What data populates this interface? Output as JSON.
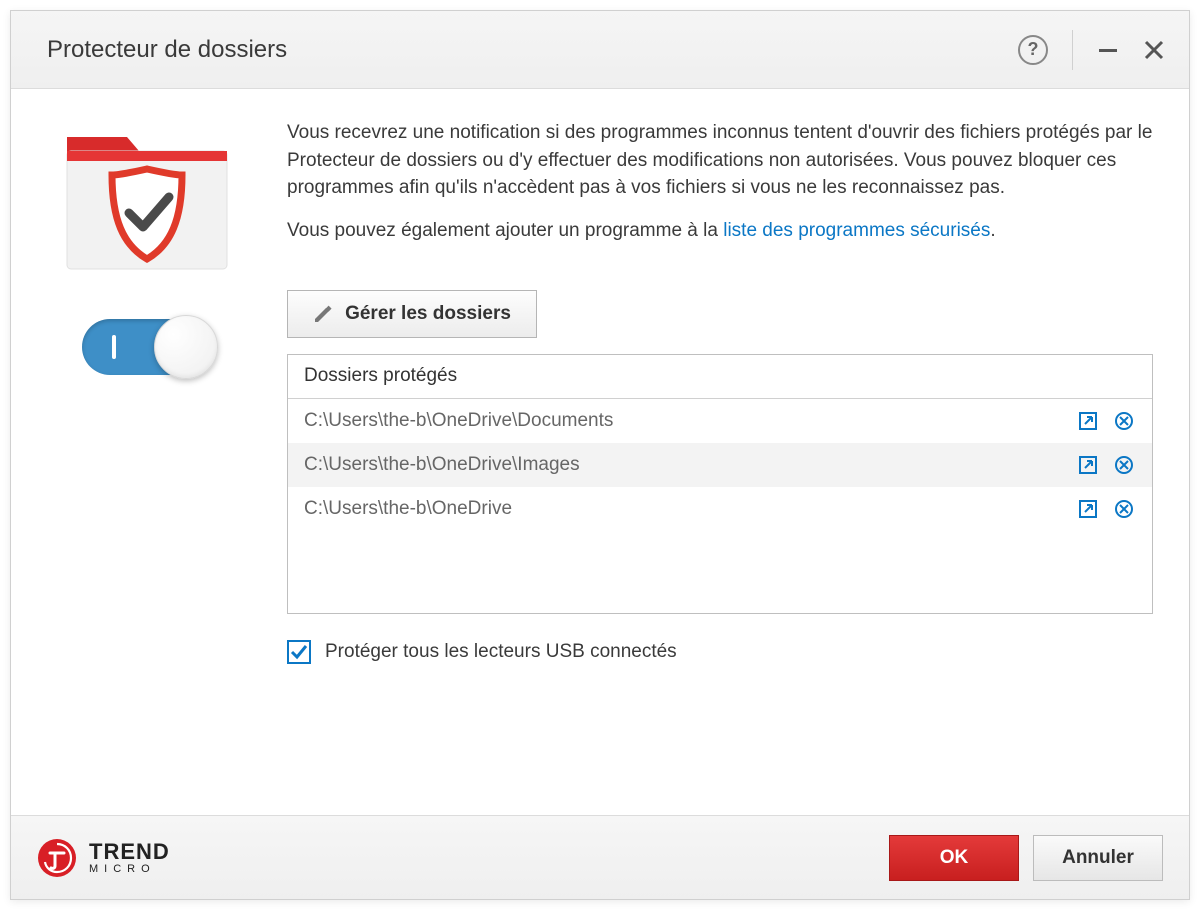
{
  "window": {
    "title": "Protecteur de dossiers"
  },
  "description": "Vous recevrez une notification si des programmes inconnus tentent d'ouvrir des fichiers protégés par le Protecteur de dossiers ou d'y effectuer des modifications non autorisées. Vous pouvez bloquer ces programmes afin qu'ils n'accèdent pas à vos fichiers si vous ne les reconnaissez pas.",
  "description2_prefix": "Vous pouvez également ajouter un programme à la ",
  "description2_link": "liste des programmes sécurisés",
  "description2_suffix": ".",
  "manage_button": "Gérer les dossiers",
  "list": {
    "header": "Dossiers protégés",
    "rows": [
      {
        "path": "C:\\Users\\the-b\\OneDrive\\Documents"
      },
      {
        "path": "C:\\Users\\the-b\\OneDrive\\Images"
      },
      {
        "path": "C:\\Users\\the-b\\OneDrive"
      }
    ]
  },
  "checkbox_label": "Protéger tous les lecteurs USB connectés",
  "footer": {
    "brand_top": "TREND",
    "brand_bottom": "MICRO",
    "ok": "OK",
    "cancel": "Annuler"
  }
}
